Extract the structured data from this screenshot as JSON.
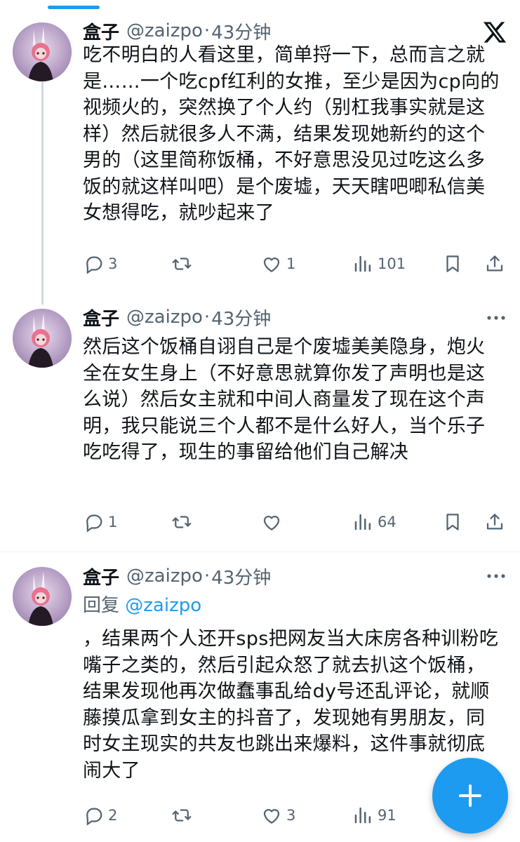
{
  "tweets": [
    {
      "display_name": "盒子",
      "handle": "@zaizpo",
      "separator": "·",
      "time": "43分钟",
      "text": "吃不明白的人看这里，简单捋一下，总而言之就是……一个吃cpf红利的女推，至少是因为cp向的视频火的，突然换了个人约（别杠我事实就是这样）然后就很多人不满，结果发现她新约的这个男的（这里简称饭桶，不好意思没见过吃这么多饭的就这样叫吧）是个废墟，天天瞎吧唧私信美女想得吃，就吵起来了",
      "reply_count": "3",
      "retweet_count": "",
      "like_count": "1",
      "view_count": "101"
    },
    {
      "display_name": "盒子",
      "handle": "@zaizpo",
      "separator": "·",
      "time": "43分钟",
      "text": "然后这个饭桶自诩自己是个废墟美美隐身，炮火全在女生身上（不好意思就算你发了声明也是这么说）然后女主就和中间人商量发了现在这个声明，我只能说三个人都不是什么好人，当个乐子吃吃得了，现生的事留给他们自己解决",
      "reply_count": "1",
      "retweet_count": "",
      "like_count": "",
      "view_count": "64"
    },
    {
      "display_name": "盒子",
      "handle": "@zaizpo",
      "separator": "·",
      "time": "43分钟",
      "reply_prefix": "回复",
      "reply_mention": "@zaizpo",
      "text": "，结果两个人还开sps把网友当大床房各种训粉吃嘴子之类的，然后引起众怒了就去扒这个饭桶，结果发现他再次做蠢事乱给dy号还乱评论，就顺藤摸瓜拿到女主的抖音了，发现她有男朋友，同时女主现实的共友也跳出来爆料，这件事就彻底闹大了",
      "reply_count": "2",
      "retweet_count": "",
      "like_count": "3",
      "view_count": "91"
    }
  ],
  "icons": {
    "brand": "x-logo-icon",
    "more": "more-dots-icon",
    "reply": "reply-icon",
    "retweet": "retweet-icon",
    "like": "heart-icon",
    "views": "views-bar-chart-icon",
    "bookmark": "bookmark-icon",
    "share": "share-icon",
    "compose": "plus-icon"
  },
  "colors": {
    "accent": "#1d9bf0",
    "text": "#0f1419",
    "secondary": "#536471",
    "thread_line": "#cfd9de"
  }
}
